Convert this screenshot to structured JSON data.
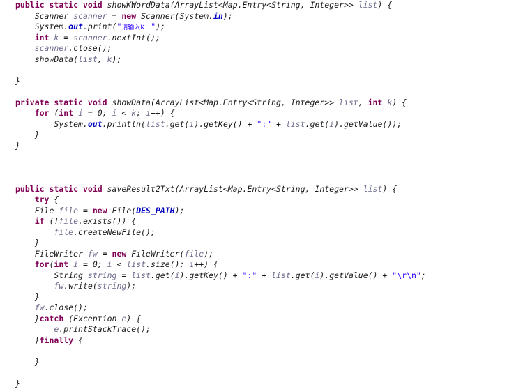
{
  "editor": {
    "language": "Java",
    "background_color": "#ffffff",
    "font_size_px": 11.5,
    "line_height_px": 15.5,
    "theme": "eclipse-light"
  },
  "syntax_colors": {
    "keyword": "#7f0055",
    "string": "#2a00ff",
    "static_field": "#0000c0",
    "local_variable": "#6c6c8c",
    "type_and_method": "#1b1b1b",
    "punctuation": "#1b1b1b"
  },
  "code": {
    "methods": [
      {
        "name": "showKWordData",
        "signature": "public static void showKWordData(ArrayList<Map.Entry<String, Integer>> list) {"
      },
      {
        "name": "showData",
        "signature": "private static void showData(ArrayList<Map.Entry<String, Integer>> list, int k) {"
      },
      {
        "name": "saveResult2Txt",
        "signature": "public static void saveResult2Txt(ArrayList<Map.Entry<String, Integer>> list) {"
      }
    ],
    "lines": [
      "public static void showKWordData(ArrayList<Map.Entry<String, Integer>> list) {",
      "    Scanner scanner = new Scanner(System.in);",
      "    System.out.print(\"请输入K：\");",
      "    int k = scanner.nextInt();",
      "    scanner.close();",
      "    showData(list, k);",
      "",
      "}",
      "",
      "private static void showData(ArrayList<Map.Entry<String, Integer>> list, int k) {",
      "    for (int i = 0; i < k; i++) {",
      "        System.out.println(list.get(i).getKey() + \":\" + list.get(i).getValue());",
      "    }",
      "}",
      "",
      "",
      "",
      "public static void saveResult2Txt(ArrayList<Map.Entry<String, Integer>> list) {",
      "    try {",
      "    File file = new File(DES_PATH);",
      "    if (!file.exists()) {",
      "        file.createNewFile();",
      "    }",
      "    FileWriter fw = new FileWriter(file);",
      "    for(int i = 0; i < list.size(); i++) {",
      "        String string = list.get(i).getKey() + \":\" + list.get(i).getValue() + \"\\r\\n\";",
      "        fw.write(string);",
      "    }",
      "    fw.close();",
      "    }catch (Exception e) {",
      "        e.printStackTrace();",
      "    }finally {",
      "",
      "    }",
      "",
      "}"
    ],
    "tokens": {
      "keywords": [
        "public",
        "private",
        "static",
        "void",
        "new",
        "int",
        "try",
        "catch",
        "finally",
        "if",
        "for"
      ],
      "strings": [
        "\"请输入K：\"",
        "\":\"",
        "\"\\r\\n\""
      ],
      "static_fields": [
        "in",
        "out",
        "DES_PATH"
      ],
      "types": [
        "Scanner",
        "System",
        "ArrayList",
        "Map.Entry",
        "String",
        "Integer",
        "File",
        "FileWriter",
        "Exception"
      ],
      "methods": [
        "showKWordData",
        "showData",
        "saveResult2Txt",
        "print",
        "println",
        "nextInt",
        "close",
        "get",
        "getKey",
        "getValue",
        "exists",
        "createNewFile",
        "size",
        "write",
        "printStackTrace"
      ],
      "variables": [
        "list",
        "scanner",
        "k",
        "i",
        "file",
        "fw",
        "string",
        "e"
      ]
    },
    "strings": {
      "prompt_cjk": "请输入K：",
      "separator": ":",
      "newline": "\\r\\n"
    },
    "constants": {
      "des_path": "DES_PATH"
    }
  }
}
